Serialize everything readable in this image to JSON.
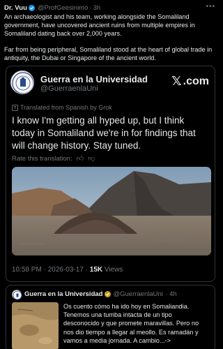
{
  "post": {
    "author_name": "Dr. Vuu",
    "author_handle": "@ProfGeesinimo",
    "separator": "·",
    "time": "3h",
    "more_icon": "more-icon",
    "paragraph1": "An archaeologist and his team, working alongside the Somaliland government, have uncovered ancient ruins from multiple empires in Somaliland dating back over 2,000 years.",
    "paragraph2": "Far from being peripheral, Somaliland stood at the heart of global trade in antiquity, the Dubai or Singapore of the ancient world."
  },
  "quote": {
    "name": "Guerra en la Universidad",
    "handle": "@GuerraenlaUni",
    "brand": ".com",
    "translated": "Translated from Spanish by Grok",
    "body": "I know I'm getting all hyped up, but I think today in Somaliland we're in for findings that will change history. Stay tuned.",
    "rate_label": "Rate this translation:",
    "time": "10:58 PM",
    "date": "2026-03-17",
    "views_count": "15K",
    "views_label": "Views",
    "meta_sep": "·"
  },
  "reply": {
    "name": "Guerra en la Universidad",
    "handle": "@GuerraenlaUni",
    "time": "4h",
    "separator": "·",
    "body": "Os cuento cómo ha ido hoy en Somaliandia. Tenemos una tumba intacta de un tipo desconocido y que promete maravillas. Pero no nos dio tiempo a llegar al meollo. Es ramadán y vamos a media jornada. A cambio...->"
  },
  "colors": {
    "background": "#000000",
    "text": "#e7e9ea",
    "secondary": "#71767b",
    "border": "#2f3336",
    "verified": "#1d9bf0"
  }
}
